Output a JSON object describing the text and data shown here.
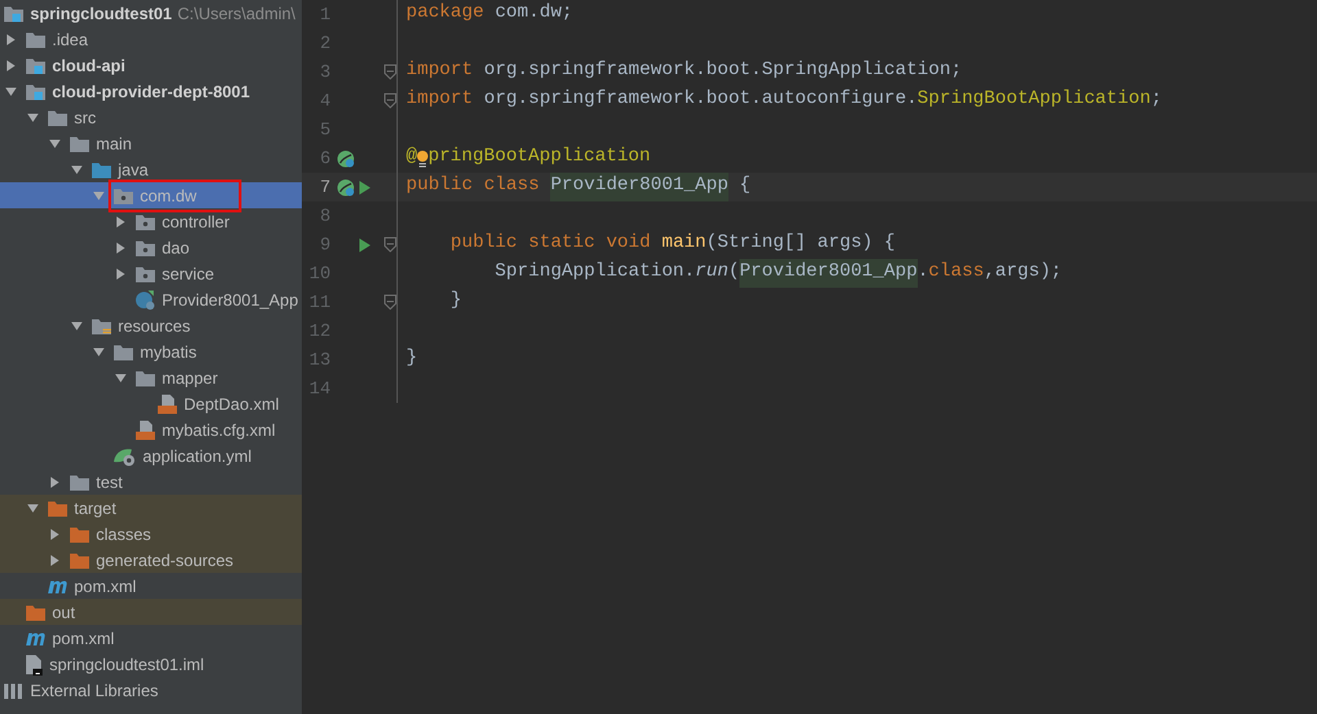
{
  "project_tree": {
    "items": [
      {
        "label": "springcloudtest01",
        "location": "C:\\Users\\admin\\",
        "kind": "module",
        "bold": true,
        "selected": false,
        "excluded": false,
        "marked": false,
        "children": [
          {
            "label": ".idea",
            "kind": "folder",
            "bold": false,
            "expanded": false,
            "selected": false,
            "excluded": false,
            "marked": false
          },
          {
            "label": "cloud-api",
            "kind": "module",
            "bold": true,
            "expanded": false,
            "selected": false,
            "excluded": false,
            "marked": false
          },
          {
            "label": "cloud-provider-dept-8001",
            "kind": "module",
            "bold": true,
            "expanded": true,
            "selected": false,
            "excluded": false,
            "marked": false,
            "children": [
              {
                "label": "src",
                "kind": "folder",
                "bold": false,
                "expanded": true,
                "selected": false,
                "excluded": false,
                "marked": false,
                "children": [
                  {
                    "label": "main",
                    "kind": "folder",
                    "bold": false,
                    "expanded": true,
                    "selected": false,
                    "excluded": false,
                    "marked": false,
                    "children": [
                      {
                        "label": "java",
                        "kind": "source-folder",
                        "bold": false,
                        "expanded": true,
                        "selected": false,
                        "excluded": false,
                        "marked": false,
                        "children": [
                          {
                            "label": "com.dw",
                            "kind": "package",
                            "bold": false,
                            "expanded": true,
                            "selected": true,
                            "excluded": false,
                            "marked": true,
                            "children": [
                              {
                                "label": "controller",
                                "kind": "package",
                                "bold": false,
                                "expanded": false,
                                "selected": false,
                                "excluded": false,
                                "marked": false
                              },
                              {
                                "label": "dao",
                                "kind": "package",
                                "bold": false,
                                "expanded": false,
                                "selected": false,
                                "excluded": false,
                                "marked": false
                              },
                              {
                                "label": "service",
                                "kind": "package",
                                "bold": false,
                                "expanded": false,
                                "selected": false,
                                "excluded": false,
                                "marked": false
                              },
                              {
                                "label": "Provider8001_App",
                                "kind": "spring-class",
                                "bold": false,
                                "selected": false,
                                "excluded": false,
                                "marked": false
                              }
                            ]
                          }
                        ]
                      },
                      {
                        "label": "resources",
                        "kind": "resources-folder",
                        "bold": false,
                        "expanded": true,
                        "selected": false,
                        "excluded": false,
                        "marked": false,
                        "children": [
                          {
                            "label": "mybatis",
                            "kind": "folder",
                            "bold": false,
                            "expanded": true,
                            "selected": false,
                            "excluded": false,
                            "marked": false,
                            "children": [
                              {
                                "label": "mapper",
                                "kind": "folder",
                                "bold": false,
                                "expanded": true,
                                "selected": false,
                                "excluded": false,
                                "marked": false,
                                "children": [
                                  {
                                    "label": "DeptDao.xml",
                                    "kind": "xml",
                                    "bold": false,
                                    "selected": false,
                                    "excluded": false,
                                    "marked": false
                                  }
                                ]
                              },
                              {
                                "label": "mybatis.cfg.xml",
                                "kind": "xml",
                                "bold": false,
                                "selected": false,
                                "excluded": false,
                                "marked": false
                              }
                            ]
                          },
                          {
                            "label": "application.yml",
                            "kind": "yml",
                            "bold": false,
                            "selected": false,
                            "excluded": false,
                            "marked": false
                          }
                        ]
                      }
                    ]
                  },
                  {
                    "label": "test",
                    "kind": "folder",
                    "bold": false,
                    "expanded": false,
                    "selected": false,
                    "excluded": false,
                    "marked": false
                  }
                ]
              },
              {
                "label": "target",
                "kind": "excluded-folder",
                "bold": false,
                "expanded": true,
                "selected": false,
                "excluded": true,
                "marked": false,
                "children": [
                  {
                    "label": "classes",
                    "kind": "excluded-folder",
                    "bold": false,
                    "expanded": false,
                    "selected": false,
                    "excluded": true,
                    "marked": false
                  },
                  {
                    "label": "generated-sources",
                    "kind": "excluded-folder",
                    "bold": false,
                    "expanded": false,
                    "selected": false,
                    "excluded": true,
                    "marked": false
                  }
                ]
              },
              {
                "label": "pom.xml",
                "kind": "maven",
                "bold": false,
                "selected": false,
                "excluded": false,
                "marked": false
              }
            ]
          },
          {
            "label": "out",
            "kind": "excluded-folder",
            "bold": false,
            "selected": false,
            "excluded": true,
            "marked": false
          },
          {
            "label": "pom.xml",
            "kind": "maven",
            "bold": false,
            "selected": false,
            "excluded": false,
            "marked": false
          },
          {
            "label": "springcloudtest01.iml",
            "kind": "iml",
            "bold": false,
            "selected": false,
            "excluded": false,
            "marked": false
          }
        ]
      },
      {
        "label": "External Libraries",
        "kind": "libraries",
        "bold": false,
        "selected": false,
        "excluded": false,
        "marked": false
      }
    ]
  },
  "editor": {
    "lines": [
      {
        "number": "1",
        "current": false,
        "fold": false,
        "bean_marker": false,
        "run_marker": false,
        "tokens": [
          {
            "kind": "keyword",
            "text": "package "
          },
          {
            "kind": "text",
            "text": "com.dw;"
          }
        ]
      },
      {
        "number": "2",
        "current": false,
        "fold": false,
        "bean_marker": false,
        "run_marker": false
      },
      {
        "number": "3",
        "current": false,
        "fold": true,
        "bean_marker": false,
        "run_marker": false,
        "tokens": [
          {
            "kind": "keyword",
            "text": "import "
          },
          {
            "kind": "text",
            "text": "org.springframework.boot.SpringApplication;"
          }
        ]
      },
      {
        "number": "4",
        "current": false,
        "fold": true,
        "bean_marker": false,
        "run_marker": false,
        "tokens": [
          {
            "kind": "keyword",
            "text": "import "
          },
          {
            "kind": "text",
            "text": "org.springframework.boot.autoconfigure."
          },
          {
            "kind": "annotation",
            "text": "SpringBootApplication"
          },
          {
            "kind": "text",
            "text": ";"
          }
        ]
      },
      {
        "number": "5",
        "current": false,
        "fold": false,
        "bean_marker": false,
        "run_marker": false
      },
      {
        "number": "6",
        "current": false,
        "fold": false,
        "bean_marker": true,
        "run_marker": false,
        "tokens": [
          {
            "kind": "annotation",
            "text": "@"
          },
          {
            "kind": "bulb"
          },
          {
            "kind": "annotation",
            "text": "pringBootApplication"
          }
        ]
      },
      {
        "number": "7",
        "current": true,
        "fold": false,
        "bean_marker": true,
        "run_marker": true,
        "tokens": [
          {
            "kind": "keyword",
            "text": "public class "
          },
          {
            "kind": "usage",
            "text": "Provider8001_App"
          },
          {
            "kind": "text",
            "text": " {"
          }
        ]
      },
      {
        "number": "8",
        "current": false,
        "fold": false,
        "bean_marker": false,
        "run_marker": false
      },
      {
        "number": "9",
        "current": false,
        "fold": true,
        "bean_marker": false,
        "run_marker": true,
        "tokens": [
          {
            "kind": "keyword",
            "text": "    public static void "
          },
          {
            "kind": "method",
            "text": "main"
          },
          {
            "kind": "text",
            "text": "(String[] args) {"
          }
        ]
      },
      {
        "number": "10",
        "current": false,
        "fold": false,
        "bean_marker": false,
        "run_marker": false,
        "tokens": [
          {
            "kind": "text",
            "text": "        SpringApplication."
          },
          {
            "kind": "static-call",
            "text": "run"
          },
          {
            "kind": "text",
            "text": "("
          },
          {
            "kind": "usage",
            "text": "Provider8001_App"
          },
          {
            "kind": "text",
            "text": "."
          },
          {
            "kind": "keyword",
            "text": "class"
          },
          {
            "kind": "text",
            "text": ",args);"
          }
        ]
      },
      {
        "number": "11",
        "current": false,
        "fold": true,
        "bean_marker": false,
        "run_marker": false,
        "tokens": [
          {
            "kind": "text",
            "text": "    }"
          }
        ]
      },
      {
        "number": "12",
        "current": false,
        "fold": false,
        "bean_marker": false,
        "run_marker": false
      },
      {
        "number": "13",
        "current": false,
        "fold": false,
        "bean_marker": false,
        "run_marker": false,
        "tokens": [
          {
            "kind": "text",
            "text": "}"
          }
        ]
      },
      {
        "number": "14",
        "current": false,
        "fold": false,
        "bean_marker": false,
        "run_marker": false
      }
    ]
  }
}
